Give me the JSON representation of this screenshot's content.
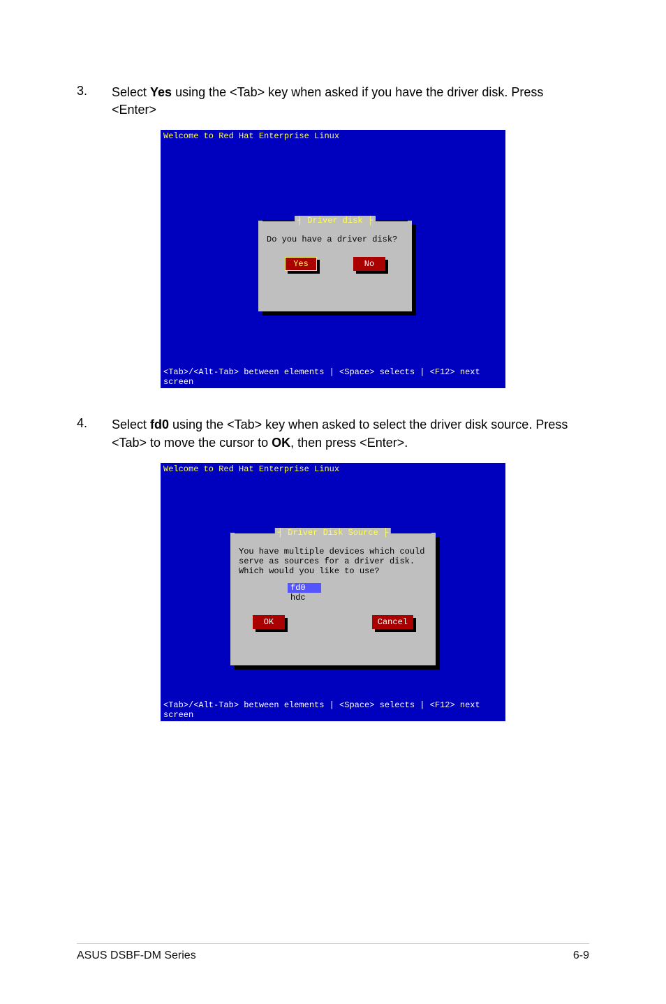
{
  "steps": {
    "s3": {
      "num": "3.",
      "pre": "Select ",
      "bold": "Yes",
      "post": " using the <Tab> key when asked if you have the driver disk. Press <Enter>"
    },
    "s4": {
      "num": "4.",
      "pre": "Select ",
      "bold1": "fd0",
      "mid": " using the <Tab> key when asked to select the driver disk source. Press <Tab> to move the cursor to ",
      "bold2": "OK",
      "post": ", then press <Enter>."
    }
  },
  "ss1": {
    "header": "Welcome to Red Hat Enterprise Linux",
    "dialog_title": "Driver disk",
    "msg": "Do you have a driver disk?",
    "yes": "Yes",
    "no": "No",
    "footer": "<Tab>/<Alt-Tab> between elements  | <Space> selects | <F12> next screen"
  },
  "ss2": {
    "header": "Welcome to Red Hat Enterprise Linux",
    "dialog_title": "Driver Disk Source",
    "msg": "You have multiple devices which could serve as sources for a driver disk. Which would you like to use?",
    "opt1": "fd0",
    "opt2": "hdc",
    "ok": "OK",
    "cancel": "Cancel",
    "footer": "<Tab>/<Alt-Tab> between elements  | <Space> selects | <F12> next screen"
  },
  "footer": {
    "left": "ASUS DSBF-DM Series",
    "right": "6-9"
  }
}
